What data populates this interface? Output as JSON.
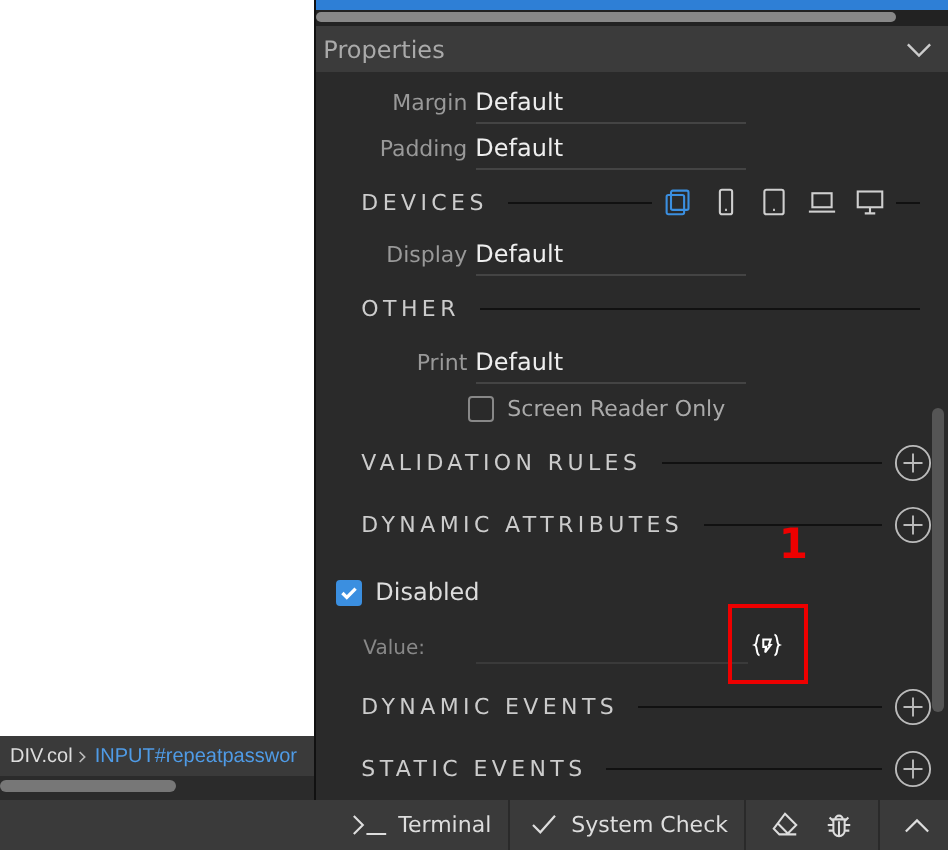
{
  "breadcrumb": [
    {
      "label": "DIV.col",
      "selected": false
    },
    {
      "label": "INPUT#repeatpasswor",
      "selected": true
    }
  ],
  "properties": {
    "title": "Properties",
    "expanded": true,
    "fields": [
      {
        "label": "Margin",
        "value": "Default"
      },
      {
        "label": "Padding",
        "value": "Default"
      }
    ],
    "devices": {
      "title": "DEVICES",
      "options": [
        {
          "kind": "all",
          "selected": true
        },
        {
          "kind": "phone",
          "selected": false
        },
        {
          "kind": "tablet",
          "selected": false
        },
        {
          "kind": "laptop",
          "selected": false
        },
        {
          "kind": "desktop",
          "selected": false
        }
      ],
      "field": {
        "label": "Display",
        "value": "Default"
      }
    },
    "other": {
      "title": "OTHER",
      "field": {
        "label": "Print",
        "value": "Default"
      },
      "checkbox": {
        "label": "Screen Reader Only",
        "checked": false
      }
    },
    "validation_rules": {
      "title": "VALIDATION RULES"
    },
    "dynamic_attributes": {
      "title": "DYNAMIC ATTRIBUTES",
      "attribute": {
        "label": "Disabled",
        "checked": true
      },
      "value_label": "Value:",
      "annotation": "1"
    },
    "dynamic_events": {
      "title": "DYNAMIC EVENTS"
    },
    "static_events": {
      "title": "STATIC EVENTS"
    }
  },
  "bottom_bar": {
    "terminal": "Terminal",
    "system_check": "System Check"
  }
}
